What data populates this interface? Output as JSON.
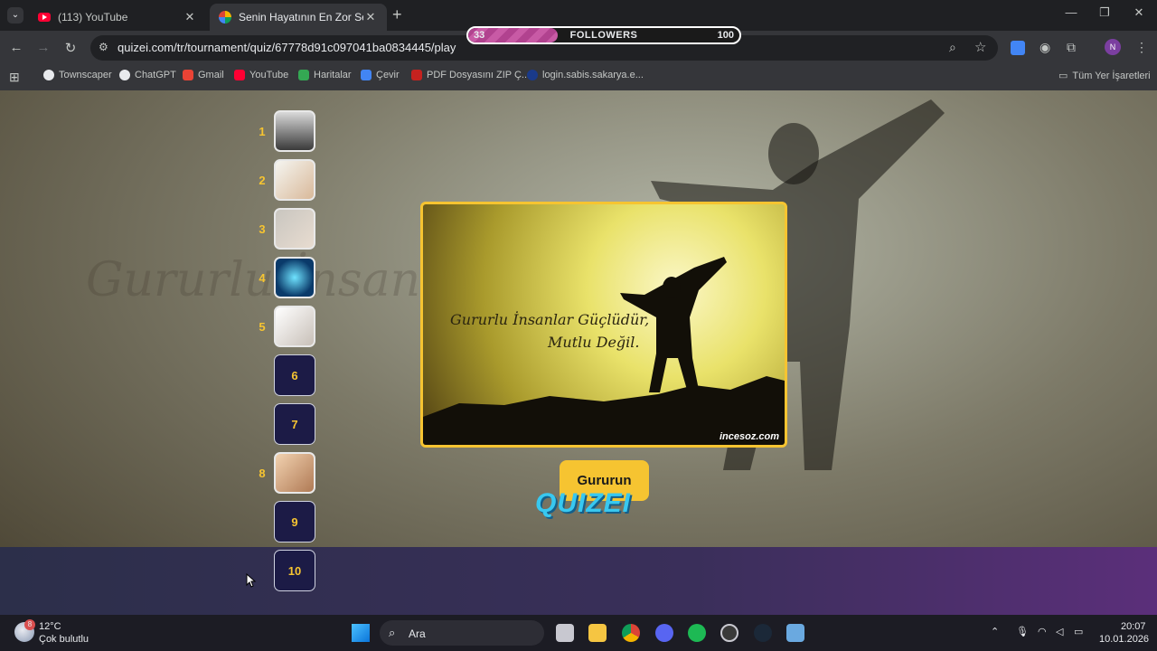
{
  "tabs": [
    {
      "title": "(113) YouTube",
      "active": false
    },
    {
      "title": "Senin Hayatının En Zor Seçimi -",
      "active": true
    }
  ],
  "followers": {
    "label": "FOLLOWERS",
    "current": "33",
    "max": "100",
    "progress": 0.33
  },
  "toolbar": {
    "url": "quizei.com/tr/tournament/quiz/67778d91c097041ba0834445/play",
    "profile_initial": "N"
  },
  "bookmarks": [
    {
      "label": "Townscaper",
      "color": "#e8eaed"
    },
    {
      "label": "ChatGPT",
      "color": "#e8eaed"
    },
    {
      "label": "Gmail",
      "color": "#ea4335"
    },
    {
      "label": "YouTube",
      "color": "#ff0033"
    },
    {
      "label": "Haritalar",
      "color": "#34a853"
    },
    {
      "label": "Çevir",
      "color": "#4285f4"
    },
    {
      "label": "PDF Dosyasını ZIP Ç...",
      "color": "#c5221f"
    },
    {
      "label": "login.sabis.sakarya.e...",
      "color": "#1a3a8a"
    }
  ],
  "all_bookmarks_label": "Tüm Yer İşaretleri",
  "ranking": [
    {
      "rank": "1",
      "label": "",
      "filled": true
    },
    {
      "rank": "2",
      "label": "",
      "filled": true
    },
    {
      "rank": "3",
      "label": "",
      "filled": true
    },
    {
      "rank": "4",
      "label": "",
      "filled": true
    },
    {
      "rank": "5",
      "label": "",
      "filled": true
    },
    {
      "rank": "",
      "label": "6",
      "filled": false
    },
    {
      "rank": "",
      "label": "7",
      "filled": false
    },
    {
      "rank": "8",
      "label": "",
      "filled": true
    },
    {
      "rank": "",
      "label": "9",
      "filled": false
    },
    {
      "rank": "",
      "label": "10",
      "filled": false
    }
  ],
  "card": {
    "quote_line1": "Gururlu İnsanlar Güçlüdür,",
    "quote_line2": "Mutlu Değil.",
    "watermark": "incesoz.com"
  },
  "choice_label": "Gururun",
  "logo_text": "QUIZEI",
  "taskbar": {
    "weather_temp": "12°C",
    "weather_desc": "Çok bulutlu",
    "weather_badge": "8",
    "search_placeholder": "Ara",
    "time": "20:07",
    "date": "10.01.2026"
  },
  "colors": {
    "accent": "#f6c431",
    "slot_bg": "#1c1b46",
    "progress": "#c85aa5"
  }
}
